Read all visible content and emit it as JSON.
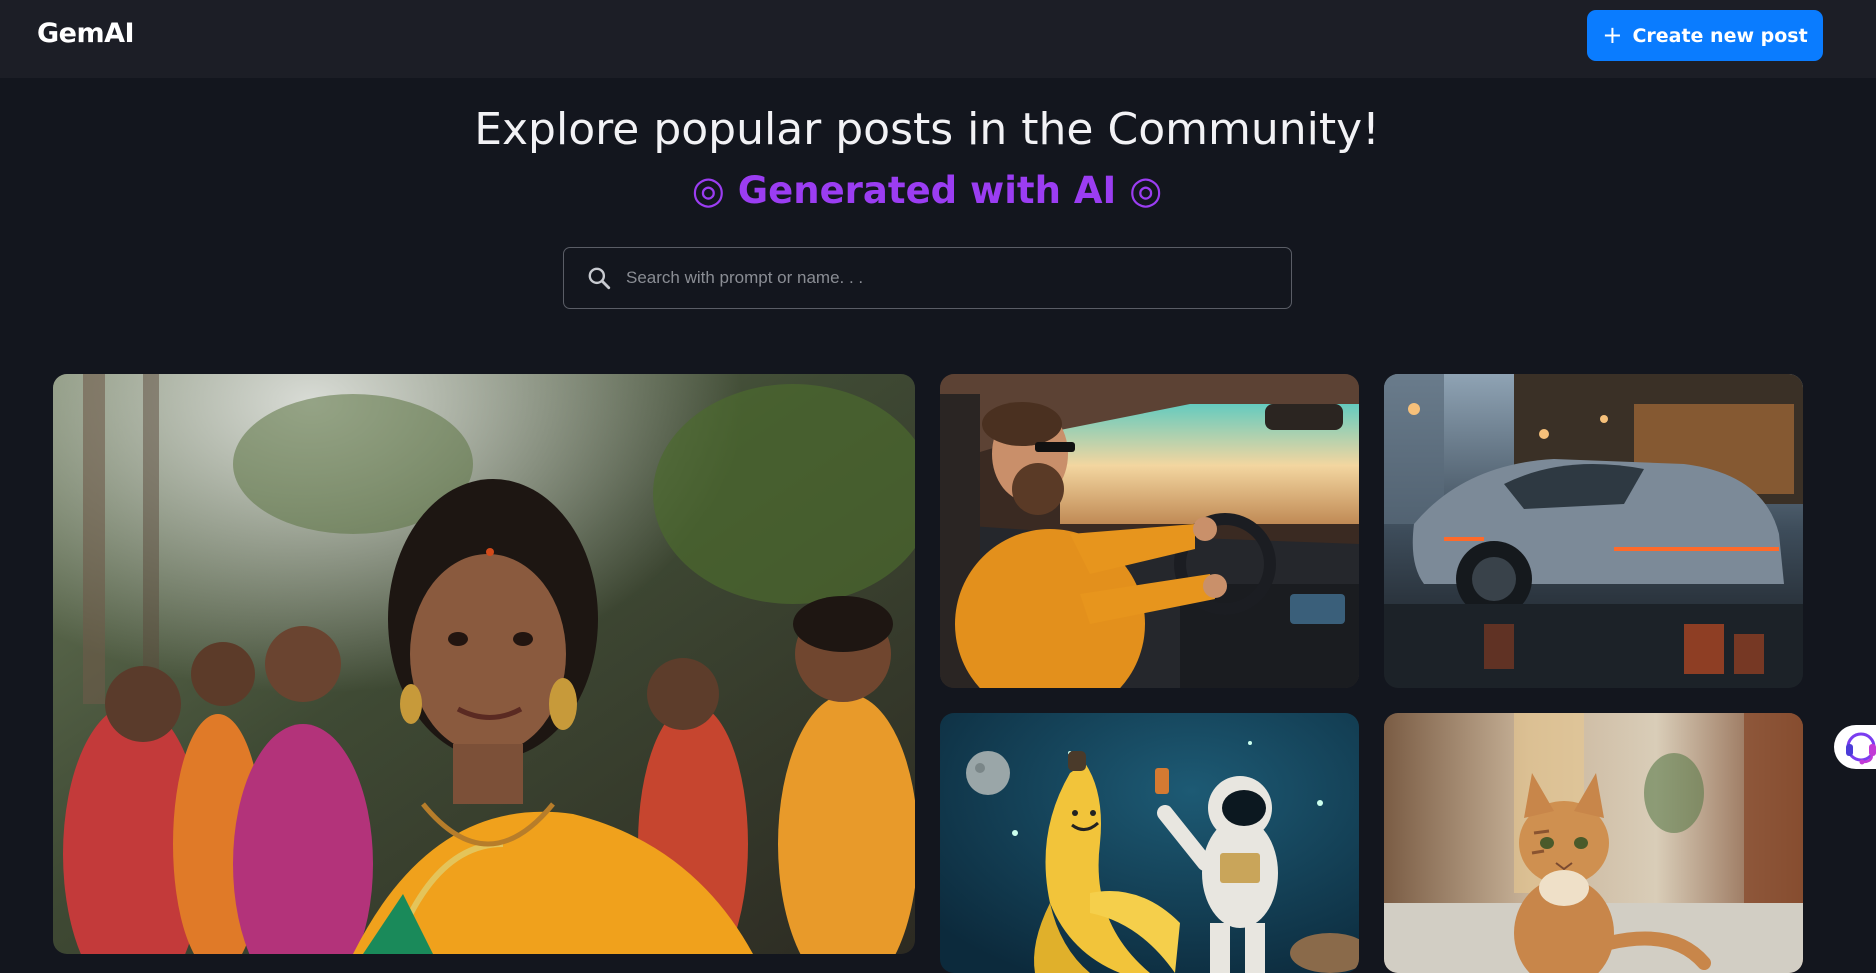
{
  "app": {
    "logo": "GemAI"
  },
  "header": {
    "create_button_label": "Create new post",
    "create_button_icon": "plus-icon"
  },
  "hero": {
    "title": "Explore popular posts in the Community!",
    "subtitle": "Generated with AI",
    "subtitle_icon": "ring-icon",
    "subtitle_color": "#9b3df2"
  },
  "search": {
    "placeholder": "Search with prompt or name. . .",
    "value": "",
    "icon": "search-icon"
  },
  "posts": [
    {
      "subject": "woman-in-saree-crowd"
    },
    {
      "subject": "man-driving-car"
    },
    {
      "subject": "futuristic-sports-car"
    },
    {
      "subject": "banana-astronaut-space"
    },
    {
      "subject": "tabby-cat-walking"
    }
  ],
  "support": {
    "icon": "headset-icon"
  },
  "colors": {
    "background": "#13161e",
    "topbar": "#1c1e26",
    "accent": "#0a7cff",
    "gradient_text": "#9b3df2"
  }
}
